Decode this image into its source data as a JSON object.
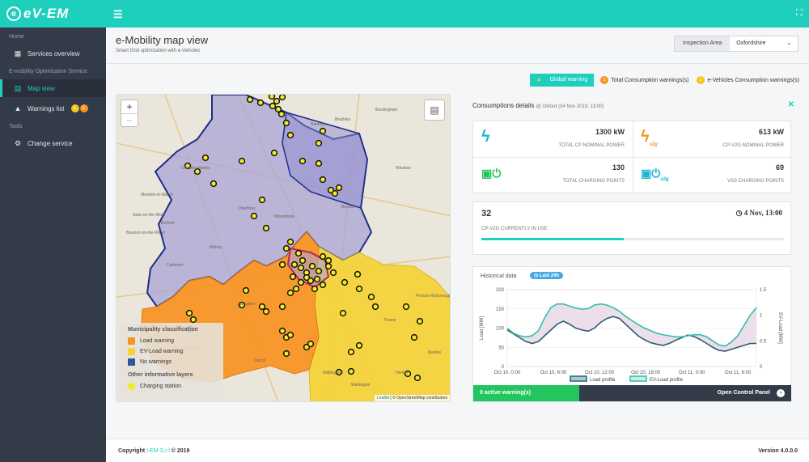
{
  "app": {
    "logo_text": "eV-EM",
    "menu_icon": "hamburger-icon",
    "fullscreen_icon": "fullscreen-icon"
  },
  "sidebar": {
    "sections": [
      {
        "header": "Home",
        "items": [
          {
            "label": "Services overview",
            "icon": "grid-icon"
          }
        ]
      },
      {
        "header": "E-mobility Optimization Service",
        "items": [
          {
            "label": "Map view",
            "icon": "map-icon",
            "active": true
          },
          {
            "label": "Warnings list",
            "icon": "warning-icon",
            "badges": [
              "1",
              "1"
            ]
          }
        ]
      },
      {
        "header": "Tools",
        "items": [
          {
            "label": "Change service",
            "icon": "cogs-icon"
          }
        ]
      }
    ]
  },
  "page": {
    "title": "e-Mobility map view",
    "subtitle": "Smart Grid optimization with e-Vehicles"
  },
  "inspection": {
    "label": "Inspection Area",
    "value": "Oxfordshire"
  },
  "warnings": {
    "global": "Global warning",
    "total_count": "1",
    "total_label": "Total Consumption warnings(s)",
    "ev_count": "1",
    "ev_label": "e-Vehicles Consumption warnings(s)"
  },
  "map": {
    "zoom_in": "+",
    "zoom_out": "−",
    "places": [
      "Banbury",
      "Brackley",
      "Buckingham",
      "Winslow",
      "Chipping Norton",
      "Charlbury",
      "Witney",
      "Carterton",
      "Bicester",
      "Woodstock",
      "Abingdon",
      "Didcot",
      "Wantage",
      "Thame",
      "Princes Risborough",
      "Henley",
      "Wallingford",
      "Faringdon",
      "Moreton-in-Marsh",
      "Stow-on-the-Wold",
      "Bourton-on-the-Water",
      "Burford",
      "Watlington",
      "Marlow"
    ],
    "legend": {
      "header1": "Municipality classification",
      "items": [
        {
          "label": "Load warning",
          "color": "#f7931e"
        },
        {
          "label": "EV-Load warning",
          "color": "#f5d335"
        },
        {
          "label": "No warnings",
          "color": "#2e5a9c"
        }
      ],
      "header2": "Other informative layers",
      "charging": {
        "label": "Charging station",
        "color": "#f2ea2a"
      }
    },
    "attribution_leaflet": "Leaflet",
    "attribution_osm": "| © OpenStreetMap contributors"
  },
  "details": {
    "title": "Consumptions details",
    "subtitle": "@ Oxford (04 Nov 2019, 13:00)",
    "close_icon": "close-icon",
    "kpis": [
      {
        "value": "1300 kW",
        "caption": "TOTAL CP NOMINAL POWER",
        "icon": "bolt-icon",
        "color": "#19b5d4"
      },
      {
        "value": "613 kW",
        "caption": "CP-V2G NOMINAL POWER",
        "icon": "bolt-v2g-icon",
        "color": "#f7931e",
        "tag": "v2g"
      },
      {
        "value": "130",
        "caption": "TOTAL CHARGING POINTS",
        "icon": "charger-icon",
        "color": "#22c55e"
      },
      {
        "value": "69",
        "caption": "V2G CHARGING POINTS",
        "icon": "charger-v2g-icon",
        "color": "#19b5d4",
        "tag": "v2g"
      }
    ],
    "in_use": {
      "value": "32",
      "date": "4 Nov, 13:00",
      "caption": "CP-V2G CURRENTLY IN USE",
      "fraction": 0.47
    },
    "historical": {
      "label": "Historical data",
      "badge": "Last 24h"
    },
    "active_warnings": "0 active warning(s)",
    "control_panel": "Open Control Panel"
  },
  "chart_data": {
    "type": "line",
    "x": [
      "Oct 10, 0:00",
      "Oct 10, 6:00",
      "Oct 10, 12:00",
      "Oct 10, 18:00",
      "Oct 11, 0:00",
      "Oct 11, 6:00"
    ],
    "ylabel": "Load [MW]",
    "y2label": "EV-Load [MW]",
    "ylim": [
      0,
      200
    ],
    "y2lim": [
      0,
      1.5
    ],
    "yticks": [
      "0",
      "50",
      "100",
      "150",
      "200"
    ],
    "y2ticks": [
      "0",
      "0.5",
      "1",
      "1.5"
    ],
    "series": [
      {
        "name": "Load profile",
        "color": "#2c5f6b",
        "axis": "left",
        "values": [
          95,
          85,
          75,
          65,
          60,
          65,
          80,
          95,
          110,
          118,
          110,
          100,
          95,
          92,
          100,
          115,
          125,
          130,
          125,
          110,
          95,
          80,
          70,
          62,
          58,
          55,
          60,
          68,
          75,
          82,
          78,
          70,
          60,
          50,
          42,
          40,
          45,
          50,
          55,
          60,
          60
        ]
      },
      {
        "name": "EV-Load profile",
        "color": "#2fbfab",
        "axis": "right",
        "values": [
          0.75,
          0.65,
          0.6,
          0.58,
          0.6,
          0.7,
          0.95,
          1.15,
          1.22,
          1.22,
          1.18,
          1.14,
          1.12,
          1.13,
          1.2,
          1.22,
          1.2,
          1.15,
          1.08,
          0.98,
          0.9,
          0.82,
          0.75,
          0.7,
          0.65,
          0.62,
          0.6,
          0.58,
          0.58,
          0.6,
          0.62,
          0.62,
          0.58,
          0.5,
          0.42,
          0.4,
          0.48,
          0.6,
          0.8,
          1.0,
          1.15
        ]
      }
    ],
    "fill_color": "#e8d6e6"
  },
  "footer": {
    "copyright_prefix": "Copyright ",
    "company": "I-EM S.r.l",
    "year": " © 2019",
    "version": "Version 4.0.0.0"
  }
}
